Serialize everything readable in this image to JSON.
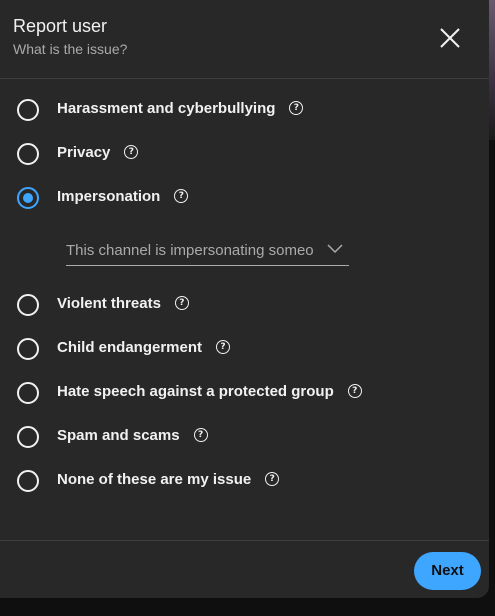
{
  "dialog": {
    "title": "Report user",
    "subtitle": "What is the issue?",
    "close_icon": "close-icon"
  },
  "options": [
    {
      "label": "Harassment and cyberbullying",
      "checked": false,
      "help_icon": "help-circle-icon"
    },
    {
      "label": "Privacy",
      "checked": false,
      "help_icon": "help-circle-icon"
    },
    {
      "label": "Impersonation",
      "checked": true,
      "help_icon": "help-circle-icon"
    },
    {
      "label": "Violent threats",
      "checked": false,
      "help_icon": "help-circle-icon"
    },
    {
      "label": "Child endangerment",
      "checked": false,
      "help_icon": "help-circle-icon"
    },
    {
      "label": "Hate speech against a protected group",
      "checked": false,
      "help_icon": "help-circle-icon"
    },
    {
      "label": "Spam and scams",
      "checked": false,
      "help_icon": "help-circle-icon"
    },
    {
      "label": "None of these are my issue",
      "checked": false,
      "help_icon": "help-circle-icon"
    }
  ],
  "impersonation_dropdown": {
    "value": "This channel is impersonating someo",
    "icon": "chevron-down-icon"
  },
  "footer": {
    "next_label": "Next"
  },
  "colors": {
    "dialog_bg": "#282828",
    "accent": "#3ea6ff",
    "text": "#f1f1f1",
    "secondary_text": "#aaaaaa"
  }
}
